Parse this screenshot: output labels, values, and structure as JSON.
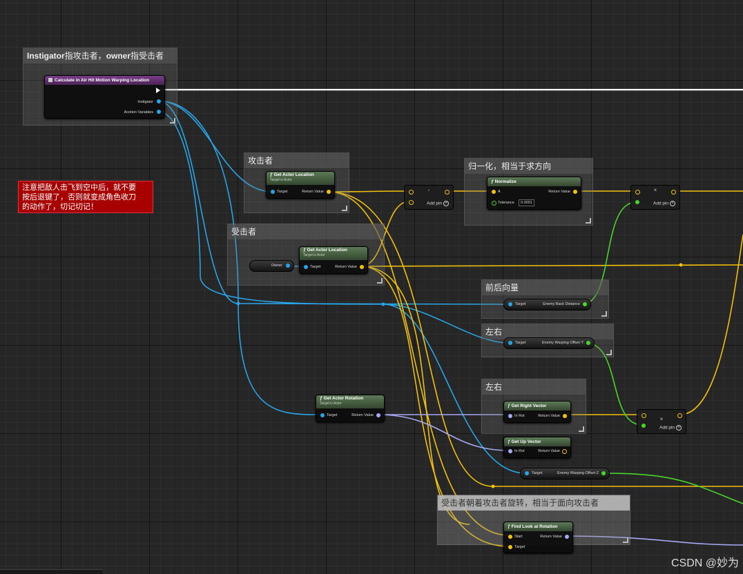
{
  "comments": {
    "top_left": {
      "title_bold": "Instigator",
      "title_rest": "指攻击者，",
      "title_bold2": "owner",
      "title_rest2": "指受击者"
    },
    "attacker": "攻击者",
    "victim": "受击者",
    "normalize": "归一化，相当于求方向",
    "forward_back": "前后向量",
    "left_right_1": "左右",
    "left_right_2": "左右",
    "rotation": "受击者朝着攻击者旋转，相当于面向攻击者"
  },
  "warning_note": {
    "lines": [
      "注意把敌人击飞到空中后，就不要",
      "按后退键了，否则就变成角色收刀",
      "的动作了，切记切记！"
    ]
  },
  "entry_node": {
    "title": "Calculate in Air Hit Motion Warping Location",
    "pins": [
      "Instigator",
      "Acotion Variables"
    ]
  },
  "get_actor_location_1": {
    "title": "Get Actor Location",
    "subtitle": "Target is Actor",
    "in": "Target",
    "out": "Return Value"
  },
  "get_actor_location_2": {
    "title": "Get Actor Location",
    "subtitle": "Target is Actor",
    "in": "Target",
    "out": "Return Value"
  },
  "owner_var": {
    "label": "Owner"
  },
  "subtract_node": {
    "symbol": "-",
    "add_pin": "Add pin"
  },
  "normalize_node": {
    "title": "Normalize",
    "in_a": "A",
    "in_tol": "Tolerance",
    "tol_value": "0.0001",
    "out": "Return Value"
  },
  "multiply_node_1": {
    "symbol": "×",
    "add_pin": "Add pin"
  },
  "multiply_node_2": {
    "symbol": "×",
    "add_pin": "Add pin"
  },
  "back_distance": {
    "in": "Target",
    "out": "Enemy Back Distance"
  },
  "offset_y": {
    "in": "Target",
    "out": "Enemy Warping Offset Y"
  },
  "offset_z": {
    "in": "Target",
    "out": "Enemy Warping Offset Z"
  },
  "get_actor_rotation": {
    "title": "Get Actor Rotation",
    "subtitle": "Target is Actor",
    "in": "Target",
    "out": "Return Value"
  },
  "get_right_vector": {
    "title": "Get Right Vector",
    "in": "In Rot",
    "out": "Return Value"
  },
  "get_up_vector": {
    "title": "Get Up Vector",
    "in": "In Rot",
    "out": "Return Value"
  },
  "find_look_at": {
    "title": "Find Look at Rotation",
    "in_start": "Start",
    "in_target": "Target",
    "out": "Return Value"
  },
  "watermark": "CSDN @妙为",
  "colors": {
    "vector": "#f2c10c",
    "object": "#29a4e6",
    "rotator": "#a7a9f5",
    "float": "#4ad52a",
    "exec": "#ffffff",
    "warning_bg": "#a80000"
  }
}
